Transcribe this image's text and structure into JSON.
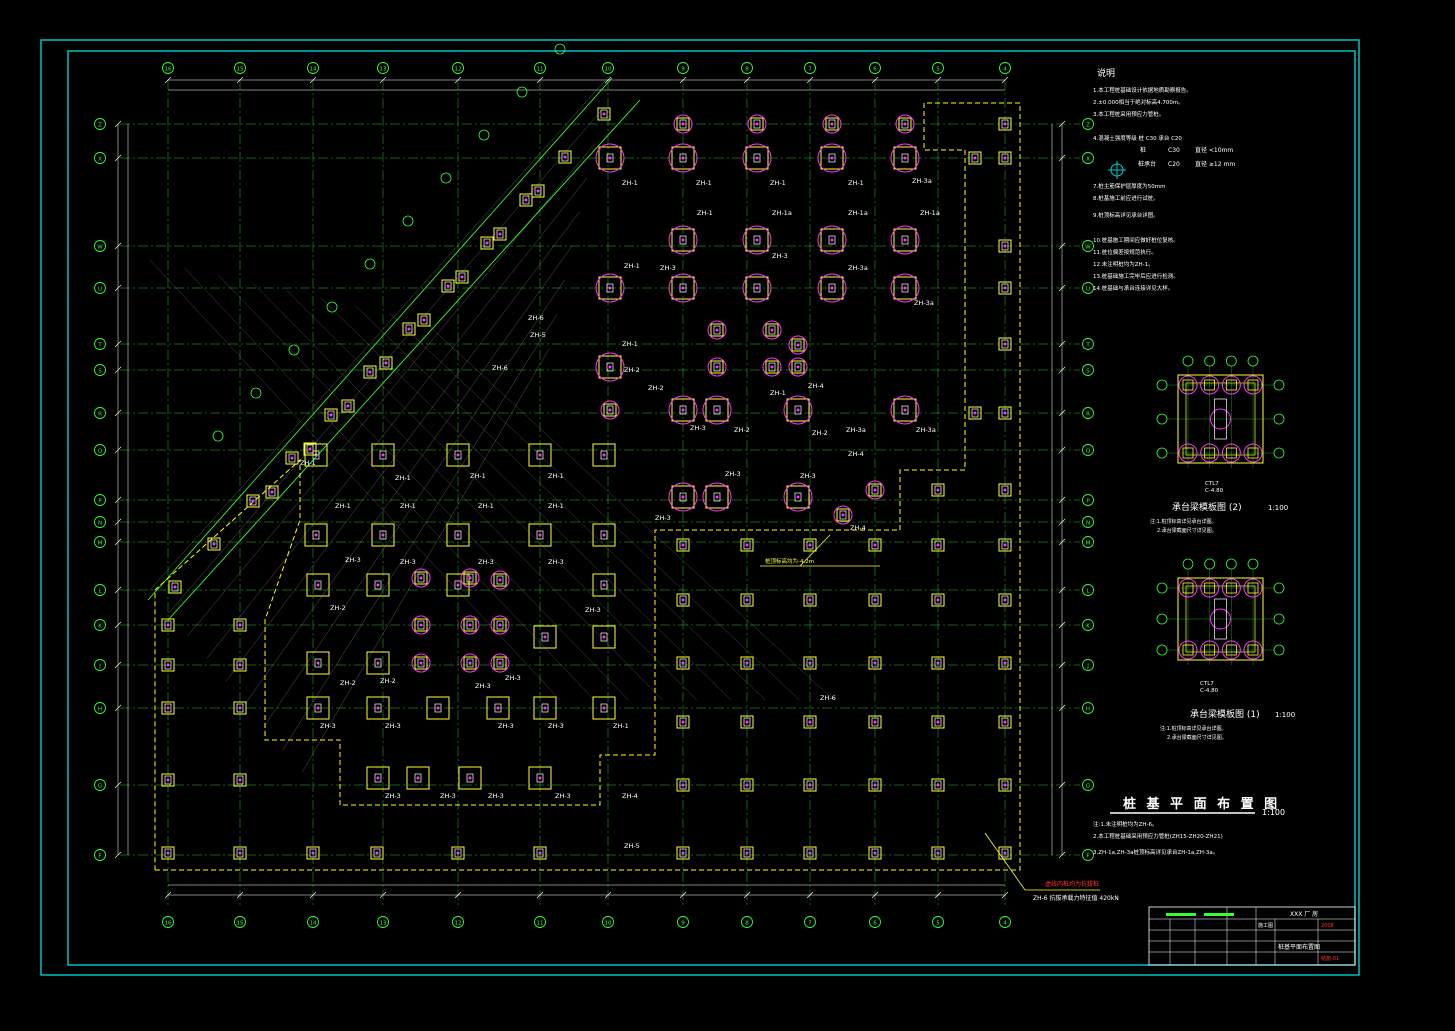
{
  "colors": {
    "background": "#000000",
    "frame": "#00d0d0",
    "grid": "#33ff33",
    "dim": "#ffffff",
    "pile": "#ffff33",
    "pile_ring": "#ff33ff",
    "pile_fill": "#c8a000",
    "outline": "#ffff00",
    "title": "#ffffff"
  },
  "notes": {
    "heading": "说明",
    "items": [
      "1.本工程桩基础设计依据地质勘察报告。",
      "2.±0.000相当于绝对标高4.700m。",
      "3.本工程桩采用预应力管桩。",
      "4.混凝土强度等级 桩 C30 承台 C20",
      "5.钢筋 直径<10mm 直径≥12mm",
      "7.桩主筋保护层厚度为50mm",
      "8.桩基施工前应进行试桩。",
      "9.桩顶标高详见承台详图。",
      "10.桩基施工期间应做好桩位复核。",
      "11.桩位偏差按规范执行。",
      "12.未注明桩均为ZH-1。",
      "13.桩基础施工完毕后应进行检测。",
      "14.桩基础与承台连接详见大样。"
    ],
    "materials": {
      "pile_label": "桩",
      "cap_label": "桩承台",
      "pile_grade": "C30",
      "cap_grade": "C20",
      "rebar_small": "直径 <10mm",
      "rebar_large": "直径 ≥12 mm"
    }
  },
  "detail_top": {
    "title": "承台梁模板图 (2)",
    "scale": "1:100",
    "note1": "注:1.桩顶标高详见承台详图。",
    "note2": "2.承台梁截面尺寸详见图。",
    "label_c": "CTL7",
    "label_d": "C-4.80"
  },
  "detail_bottom": {
    "title": "承台梁模板图 (1)",
    "scale": "1:100",
    "note1": "注:1.桩顶标高详见承台详图。",
    "note2": "2.承台梁截面尺寸详见图。",
    "label_c": "CTL7",
    "label_d": "C-4.80"
  },
  "plan": {
    "title": "桩 基 平 面 布 置 图",
    "scale": "1:100",
    "note1": "注:1.未注明桩均为ZH-6。",
    "note2": "2.本工程桩基础采用预应力管桩(ZH15-ZH20-ZH21)",
    "note3": "3.ZH-1a,ZH-3a桩顶标高详见承台ZH-1a,ZH-3a。",
    "callout1": "虚线内桩均为抗拔桩",
    "callout2": "ZH-6 抗拔承载力特征值 420kN",
    "callout3": "桩顶标高均为-4.2m",
    "pile_labels": [
      "ZH-1",
      "ZH-1a",
      "ZH-2",
      "ZH-3",
      "ZH-3a",
      "ZH-4",
      "ZH-5",
      "ZH-6"
    ]
  },
  "axes_top": [
    "16",
    "15",
    "14",
    "13",
    "12",
    "11",
    "10",
    "9",
    "8",
    "7",
    "6",
    "5",
    "4",
    "3",
    "2"
  ],
  "axes_right": [
    "Z",
    "X",
    "W",
    "U",
    "T",
    "S",
    "R",
    "Q",
    "P",
    "N",
    "M",
    "L",
    "K",
    "J",
    "H",
    "G",
    "F",
    "E",
    "D",
    "C",
    "B",
    "A"
  ],
  "title_block": {
    "project": "XXX 厂 房",
    "drawing": "桩基平面布置图",
    "stage": "施工图",
    "sheet": "结施-01",
    "date": "2008"
  }
}
